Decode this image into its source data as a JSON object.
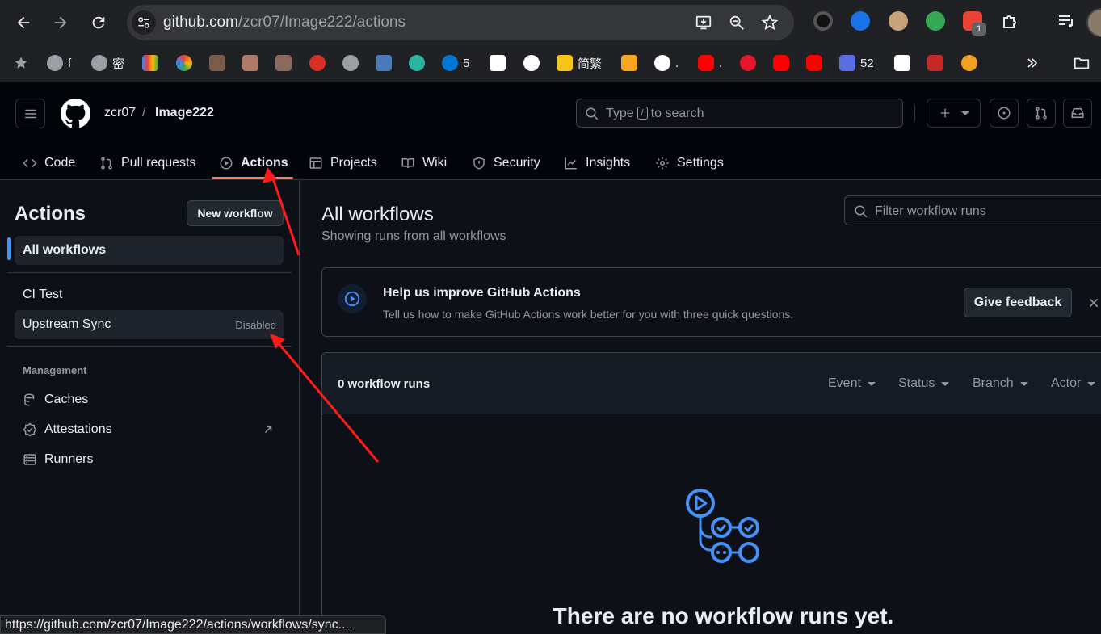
{
  "browser": {
    "url_host": "github.com",
    "url_path": "/zcr07/Image222/actions",
    "extension_badge": "1",
    "bookmarks": [
      {
        "label": "",
        "icon": "star-icon"
      },
      {
        "label": "f",
        "icon": "globe-icon"
      },
      {
        "label": "密",
        "icon": "globe-icon"
      },
      {
        "label": "",
        "icon": "gmail-icon"
      },
      {
        "label": "",
        "icon": "photos-icon"
      },
      {
        "label": "",
        "icon": "avatar-icon"
      },
      {
        "label": "",
        "icon": "avatar-icon"
      },
      {
        "label": "",
        "icon": "avatar-icon"
      },
      {
        "label": "",
        "icon": "flag-icon"
      },
      {
        "label": "",
        "icon": "globe-icon"
      },
      {
        "label": "",
        "icon": "hux-icon"
      },
      {
        "label": "",
        "icon": "fish-icon"
      },
      {
        "label": "5",
        "icon": "onedrive-icon"
      },
      {
        "label": "",
        "icon": "glyph-icon"
      },
      {
        "label": "",
        "icon": "openai-icon"
      },
      {
        "label": "简繁",
        "icon": "byv-icon"
      },
      {
        "label": "",
        "icon": "bolt-icon"
      },
      {
        "label": ".",
        "icon": "github-icon"
      },
      {
        "label": ".",
        "icon": "youtube-icon"
      },
      {
        "label": "",
        "icon": "weibo-icon"
      },
      {
        "label": "",
        "icon": "youtube-icon"
      },
      {
        "label": "",
        "icon": "youtube-icon"
      },
      {
        "label": "52",
        "icon": "c-icon"
      },
      {
        "label": "",
        "icon": "cloud-icon"
      },
      {
        "label": "",
        "icon": "seal-icon"
      },
      {
        "label": "",
        "icon": "orange-icon"
      }
    ],
    "status_url": "https://github.com/zcr07/Image222/actions/workflows/sync...."
  },
  "header": {
    "owner": "zcr07",
    "separator": "/",
    "repo": "Image222",
    "search_prefix": "Type",
    "search_key": "/",
    "search_suffix": "to search"
  },
  "tabs": [
    {
      "label": "Code",
      "icon": "code-icon"
    },
    {
      "label": "Pull requests",
      "icon": "pull-request-icon"
    },
    {
      "label": "Actions",
      "icon": "play-icon",
      "active": true
    },
    {
      "label": "Projects",
      "icon": "table-icon"
    },
    {
      "label": "Wiki",
      "icon": "book-icon"
    },
    {
      "label": "Security",
      "icon": "shield-icon"
    },
    {
      "label": "Insights",
      "icon": "graph-icon"
    },
    {
      "label": "Settings",
      "icon": "gear-icon"
    }
  ],
  "sidebar": {
    "title": "Actions",
    "new_workflow": "New workflow",
    "all_workflows": "All workflows",
    "workflows": [
      {
        "label": "CI Test",
        "status": ""
      },
      {
        "label": "Upstream Sync",
        "status": "Disabled"
      }
    ],
    "management_label": "Management",
    "management": [
      {
        "label": "Caches",
        "icon": "database-icon"
      },
      {
        "label": "Attestations",
        "icon": "verified-icon"
      },
      {
        "label": "Runners",
        "icon": "server-icon"
      }
    ]
  },
  "main": {
    "title": "All workflows",
    "subtitle": "Showing runs from all workflows",
    "filter_placeholder": "Filter workflow runs",
    "banner": {
      "title": "Help us improve GitHub Actions",
      "description": "Tell us how to make GitHub Actions work better for you with three quick questions.",
      "button": "Give feedback"
    },
    "runs": {
      "count_label": "0 workflow runs",
      "filters": [
        "Event",
        "Status",
        "Branch",
        "Actor"
      ],
      "empty_title": "There are no workflow runs yet."
    }
  },
  "colors": {
    "accent": "#4493f8",
    "active_tab": "#f78166",
    "annotation_arrow": "#ff1a1a"
  }
}
